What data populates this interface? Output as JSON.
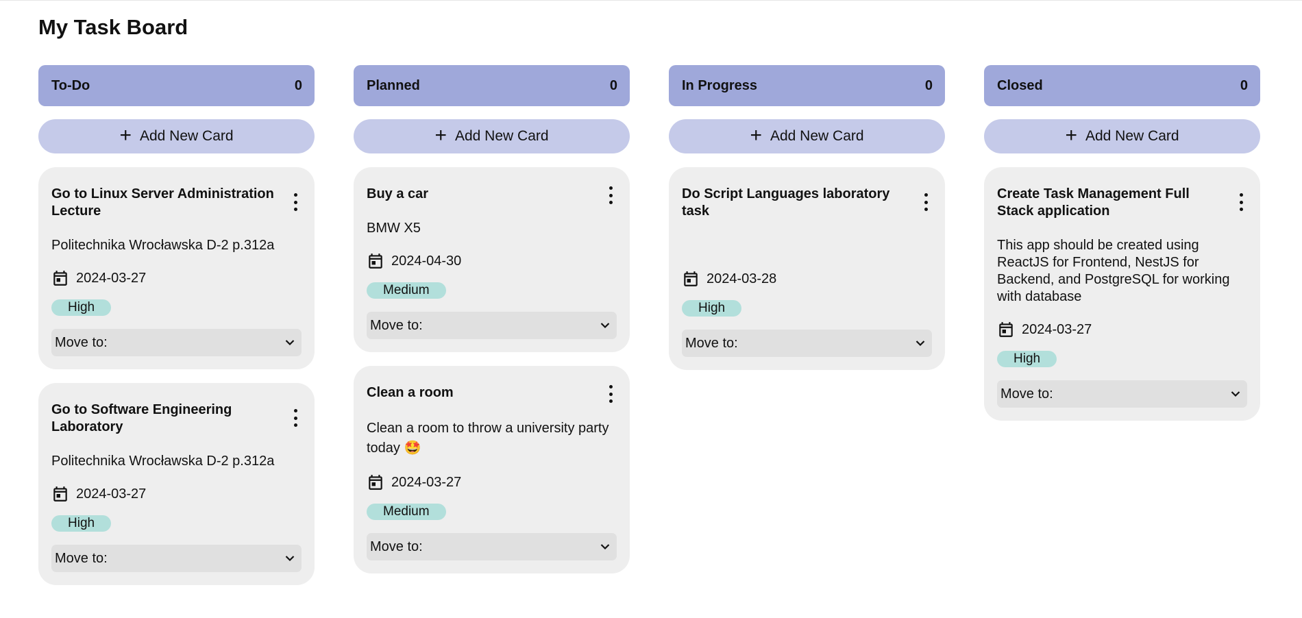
{
  "page": {
    "title": "My Task Board"
  },
  "columns": [
    {
      "title": "To-Do",
      "count": "0",
      "add_label": "Add New Card",
      "cards": [
        {
          "title": "Go to Linux Server Administration Lecture",
          "description": "Politechnika Wrocławska D-2 p.312a",
          "date": "2024-03-27",
          "priority": "High",
          "move_label": "Move to:"
        },
        {
          "title": "Go to Software Engineering Laboratory",
          "description": "Politechnika Wrocławska D-2 p.312a",
          "date": "2024-03-27",
          "priority": "High",
          "move_label": "Move to:"
        }
      ]
    },
    {
      "title": "Planned",
      "count": "0",
      "add_label": "Add New Card",
      "cards": [
        {
          "title": "Buy a car",
          "description": "BMW X5",
          "date": "2024-04-30",
          "priority": "Medium",
          "move_label": "Move to:"
        },
        {
          "title": "Clean a room",
          "description": "Clean a room to throw a university party today 🤩",
          "date": "2024-03-27",
          "priority": "Medium",
          "move_label": "Move to:"
        }
      ]
    },
    {
      "title": "In Progress",
      "count": "0",
      "add_label": "Add New Card",
      "cards": [
        {
          "title": "Do Script Languages laboratory task",
          "description": "",
          "date": "2024-03-28",
          "priority": "High",
          "move_label": "Move to:"
        }
      ]
    },
    {
      "title": "Closed",
      "count": "0",
      "add_label": "Add New Card",
      "cards": [
        {
          "title": "Create Task Management Full Stack application",
          "description": "This app should be created using ReactJS for Frontend, NestJS for Backend, and PostgreSQL for working with database",
          "date": "2024-03-27",
          "priority": "High",
          "move_label": "Move to:"
        }
      ]
    }
  ],
  "colors": {
    "header": "#9fa8da",
    "add_button": "#c5cae9",
    "card": "#eeeeee",
    "badge": "#b2dfdb"
  },
  "icons": {
    "add": "plus-icon",
    "menu": "more-vert-icon",
    "date": "calendar-icon",
    "select": "chevron-down-icon"
  }
}
